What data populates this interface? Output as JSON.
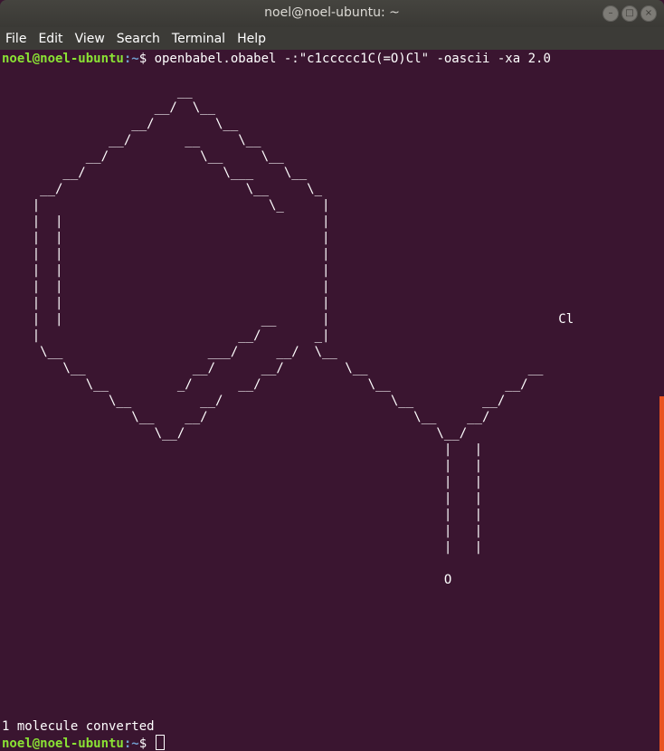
{
  "window": {
    "title": "noel@noel-ubuntu: ~",
    "buttons": {
      "minimize": "–",
      "maximize": "□",
      "close": "×"
    }
  },
  "menu": {
    "items": [
      {
        "label": "File"
      },
      {
        "label": "Edit"
      },
      {
        "label": "View"
      },
      {
        "label": "Search"
      },
      {
        "label": "Terminal"
      },
      {
        "label": "Help"
      }
    ]
  },
  "terminal": {
    "prompt_user": "noel@noel-ubuntu",
    "prompt_path": ":~",
    "prompt_symbol": "$ ",
    "command": "openbabel.obabel -:\"c1ccccc1C(=O)Cl\" -oascii -xa 2.0",
    "ascii_art": "                       __\n                    __/  \\__\n                 __/        \\__\n              __/       __     \\__\n           __/            \\__     \\__\n        __/                  \\___    \\__\n     __/                        \\__     \\_\n    |                              \\_     |\n    |  |                                  |\n    |  |                                  |\n    |  |                                  |\n    |  |                                  |\n    |  |                                  |\n    |  |                                  |\n    |  |                          __      |                              Cl\n    |                          __/       _|\n     \\__                   ___/     __/  \\__\n        \\__              __/      __/        \\__                     __\n           \\__         _/      __/              \\__               __/\n              \\__         __/                      \\__         __/\n                 \\__    __/                           \\__    __/\n                    \\__/                                 \\__/\n                                                          |   |\n                                                          |   |\n                                                          |   |\n                                                          |   |\n                                                          |   |\n                                                          |   |\n                                                          |   |\n\n                                                          O",
    "output": "1 molecule converted"
  },
  "colors": {
    "background": "#3a1530",
    "prompt_user": "#8ae234",
    "prompt_path": "#729fcf",
    "scroll_accent": "#e95420"
  }
}
